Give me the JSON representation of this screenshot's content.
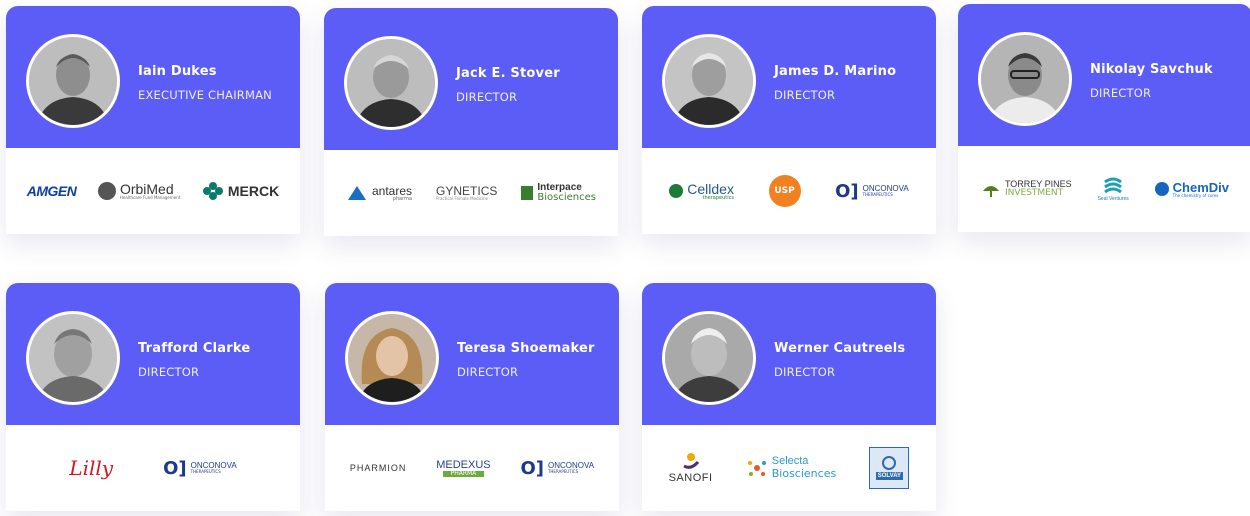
{
  "members": [
    {
      "name": "Iain Dukes",
      "role": "EXECUTIVE CHAIRMAN",
      "logos": [
        {
          "text": "AMGEN",
          "icon": "amgen-logo",
          "color": "#0b3fa8"
        },
        {
          "text": "OrbiMed",
          "sub": "Healthcare Fund Management",
          "icon": "orbimed-logo",
          "color": "#333333"
        },
        {
          "text": "MERCK",
          "icon": "merck-logo",
          "color": "#0a7a6c"
        }
      ]
    },
    {
      "name": "Jack E. Stover",
      "role": "DIRECTOR",
      "logos": [
        {
          "text": "antares",
          "sub": "pharma",
          "icon": "antares-logo",
          "color": "#1a6fc0"
        },
        {
          "text": "GYNETICS",
          "sub": "Practical Female Medicine",
          "icon": "gynetics-logo",
          "color": "#444444"
        },
        {
          "text": "Interpace",
          "sub": "Biosciences",
          "icon": "interpace-logo",
          "color": "#3a7d2c"
        }
      ]
    },
    {
      "name": "James D. Marino",
      "role": "DIRECTOR",
      "logos": [
        {
          "text": "Celldex",
          "sub": "therapeutics",
          "icon": "celldex-logo",
          "color": "#1f7a3a"
        },
        {
          "text": "USP",
          "icon": "usp-logo",
          "color": "#f08020"
        },
        {
          "text": "ONCONOVA",
          "sub": "THERAPEUTICS",
          "icon": "onconova-logo",
          "color": "#1b3a8c"
        }
      ]
    },
    {
      "name": "Nikolay Savchuk",
      "role": "DIRECTOR",
      "logos": [
        {
          "text": "TORREY PINES",
          "sub": "INVESTMENT",
          "icon": "torrey-pines-logo",
          "color": "#6b8a2a"
        },
        {
          "text": "Seal Ventures",
          "icon": "seal-ventures-logo",
          "color": "#1aa0b0"
        },
        {
          "text": "ChemDiv",
          "sub": "The chemistry of cures",
          "icon": "chemdiv-logo",
          "color": "#1565c0"
        }
      ]
    },
    {
      "name": "Trafford Clarke",
      "role": "DIRECTOR",
      "logos": [
        {
          "text": "Lilly",
          "icon": "lilly-logo",
          "color": "#d3152a"
        },
        {
          "text": "ONCONOVA",
          "sub": "THERAPEUTICS",
          "icon": "onconova-logo",
          "color": "#1b3a8c"
        }
      ]
    },
    {
      "name": "Teresa Shoemaker",
      "role": "DIRECTOR",
      "logos": [
        {
          "text": "PHARMION",
          "icon": "pharmion-logo",
          "color": "#333333"
        },
        {
          "text": "MEDEXUS",
          "sub": "PHARMA",
          "icon": "medexus-logo",
          "color": "#2a3f8c"
        },
        {
          "text": "ONCONOVA",
          "sub": "THERAPEUTICS",
          "icon": "onconova-logo",
          "color": "#1b3a8c"
        }
      ]
    },
    {
      "name": "Werner Cautreels",
      "role": "DIRECTOR",
      "logos": [
        {
          "text": "SANOFI",
          "icon": "sanofi-logo",
          "color": "#4a2a7a"
        },
        {
          "text": "Selecta",
          "sub": "Biosciences",
          "icon": "selecta-logo",
          "color": "#2a9ad0"
        },
        {
          "text": "SOLVAY",
          "icon": "solvay-logo",
          "color": "#2b6cb0"
        }
      ]
    }
  ]
}
